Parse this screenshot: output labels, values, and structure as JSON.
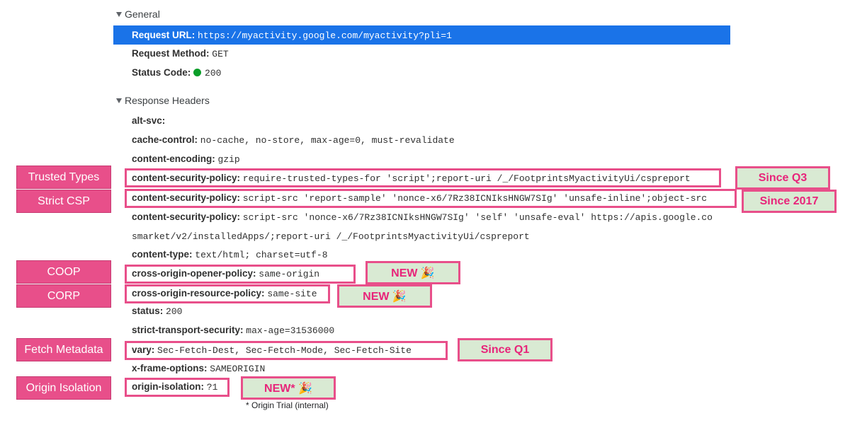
{
  "general": {
    "header": "General",
    "request_url_label": "Request URL:",
    "request_url_value": "https://myactivity.google.com/myactivity?pli=1",
    "request_method_label": "Request Method:",
    "request_method_value": "GET",
    "status_code_label": "Status Code:",
    "status_code_value": "200"
  },
  "response_headers": {
    "header": "Response Headers",
    "rows": [
      {
        "k": "alt-svc:",
        "v": ""
      },
      {
        "k": "cache-control:",
        "v": "no-cache, no-store, max-age=0, must-revalidate"
      },
      {
        "k": "content-encoding:",
        "v": "gzip"
      },
      {
        "k": "content-security-policy:",
        "v": "require-trusted-types-for 'script';report-uri /_/FootprintsMyactivityUi/cspreport"
      },
      {
        "k": "content-security-policy:",
        "v": "script-src 'report-sample' 'nonce-x6/7Rz38ICNIksHNGW7SIg' 'unsafe-inline';object-src"
      },
      {
        "k": "content-security-policy:",
        "v": "script-src 'nonce-x6/7Rz38ICNIksHNGW7SIg' 'self' 'unsafe-eval' https://apis.google.co"
      },
      {
        "k": "",
        "v": "smarket/v2/installedApps/;report-uri /_/FootprintsMyactivityUi/cspreport"
      },
      {
        "k": "content-type:",
        "v": "text/html; charset=utf-8"
      },
      {
        "k": "cross-origin-opener-policy:",
        "v": "same-origin"
      },
      {
        "k": "cross-origin-resource-policy:",
        "v": "same-site"
      },
      {
        "k": "status:",
        "v": "200"
      },
      {
        "k": "strict-transport-security:",
        "v": "max-age=31536000"
      },
      {
        "k": "vary:",
        "v": "Sec-Fetch-Dest, Sec-Fetch-Mode, Sec-Fetch-Site"
      },
      {
        "k": "x-frame-options:",
        "v": "SAMEORIGIN"
      },
      {
        "k": "origin-isolation:",
        "v": "?1"
      }
    ]
  },
  "tags": {
    "trusted_types": "Trusted Types",
    "strict_csp": "Strict CSP",
    "coop": "COOP",
    "corp": "CORP",
    "fetch_metadata": "Fetch Metadata",
    "origin_isolation": "Origin Isolation"
  },
  "notes": {
    "since_q3": "Since Q3",
    "since_2017": "Since 2017",
    "new_coop": "NEW 🎉",
    "new_corp": "NEW 🎉",
    "since_q1": "Since Q1",
    "new_origin": "NEW* 🎉"
  },
  "footnote": "* Origin Trial (internal)",
  "colors": {
    "selection": "#1a73e8",
    "accent_pink": "#e84f8a",
    "note_green": "#d9ead3",
    "status_green": "#0a9e29"
  }
}
